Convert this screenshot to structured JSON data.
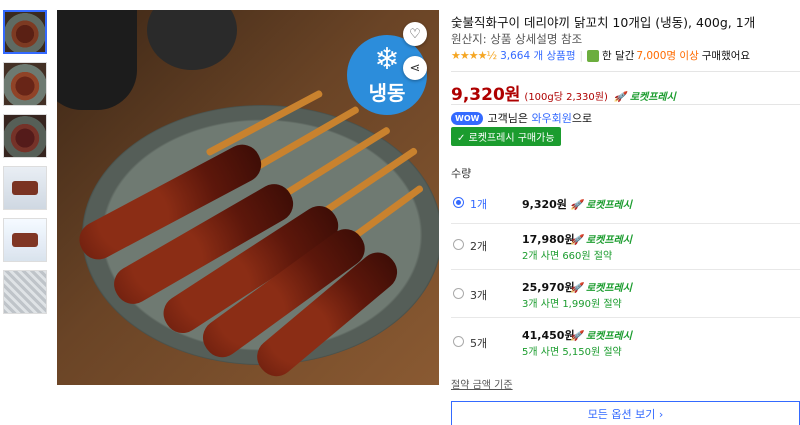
{
  "product": {
    "title": "숯불직화구이 데리야끼 닭꼬치 10개입 (냉동), 400g, 1개",
    "origin": "원산지: 상품 상세설명 참조",
    "stars": "★★★★½",
    "review_count": "3,664 개 상품평",
    "purchase_prefix": "한 달간",
    "purchase_count": "7,000명 이상",
    "purchase_suffix": "구매했어요"
  },
  "image": {
    "freeze_badge": "냉동",
    "snowflake_icon": "❄",
    "heart_icon": "♡",
    "share_icon": "⋖"
  },
  "price": {
    "main": "9,320원",
    "unit": "(100g당 2,330원)",
    "rocket_label": "로켓프레시"
  },
  "wow": {
    "badge": "WOW",
    "text_prefix": "고객님은",
    "link": "와우회원",
    "text_suffix": "으로"
  },
  "rocket_buy_label": "✓ 로켓프레시 구매가능",
  "quantity_label": "수량",
  "options": [
    {
      "qty": "1개",
      "price": "9,320원",
      "rocket": "로켓프레시",
      "saving": "",
      "selected": true
    },
    {
      "qty": "2개",
      "price": "17,980원",
      "rocket": "로켓프레시",
      "saving": "2개 사면 660원 절약",
      "selected": false
    },
    {
      "qty": "3개",
      "price": "25,970원",
      "rocket": "로켓프레시",
      "saving": "3개 사면 1,990원 절약",
      "selected": false
    },
    {
      "qty": "5개",
      "price": "41,450원",
      "rocket": "로켓프레시",
      "saving": "5개 사면 5,150원 절약",
      "selected": false
    }
  ],
  "unit_price_link": "절약 금액 기준",
  "all_options_button": "모든 옵션 보기 ›",
  "colors": {
    "price_red": "#ae0000",
    "accent_blue": "#346aff",
    "rocket_green": "#1b9c2e",
    "buy_orange": "#ff6b00",
    "freeze_blue": "#2c8ddb"
  }
}
